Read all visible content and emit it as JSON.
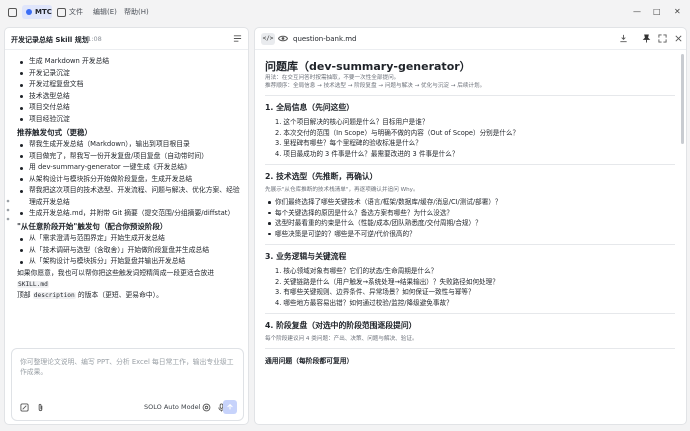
{
  "titlebar": {
    "app_label": "MTC",
    "menus": [
      "文件",
      "编辑(E)",
      "帮助(H)"
    ],
    "controls": [
      "—",
      "□",
      "✕"
    ]
  },
  "left": {
    "title": "开发记录总结 Skill 规划",
    "time": "21:08",
    "items": [
      {
        "kind": "li",
        "text": "生成 Markdown 开发总结"
      },
      {
        "kind": "li",
        "text": "开发记录沉淀"
      },
      {
        "kind": "li",
        "text": "开发过程复盘文档"
      },
      {
        "kind": "li",
        "text": "技术选型总结"
      },
      {
        "kind": "li",
        "text": "项目交付总结"
      },
      {
        "kind": "li",
        "text": "项目经验沉淀"
      },
      {
        "kind": "sec",
        "text": "推荐触发句式（更稳）"
      },
      {
        "kind": "li",
        "text": "帮我生成开发总结（Markdown），输出到项目根目录"
      },
      {
        "kind": "li",
        "text": "项目做完了，帮我写一份开发复盘/项目复盘（自动带时间）"
      },
      {
        "kind": "li",
        "text": "用 dev-summary-generator 一键生成《开发总结》"
      },
      {
        "kind": "li",
        "text": "从架构设计与模块拆分开始做阶段复盘，生成开发总结"
      },
      {
        "kind": "li",
        "text": "帮我把这次项目的技术选型、开发流程、问题与解决、优化方案、经验整"
      },
      {
        "kind": "cont",
        "text": "理成开发总结"
      },
      {
        "kind": "li",
        "text": "生成开发总结.md，并附带 Git 摘要（提交范围/分组摘要/diffstat）"
      },
      {
        "kind": "sec",
        "text": "\"从任意阶段开始\"触发句（配合你预设阶段）"
      },
      {
        "kind": "li",
        "text": "从「需求澄清与范围界定」开始生成开发总结"
      },
      {
        "kind": "li",
        "text": "从「技术调研与选型（含取舍）」开始做阶段复盘并生成总结"
      },
      {
        "kind": "li",
        "text": "从「架构设计与模块拆分」开始复盘并输出开发总结"
      },
      {
        "kind": "para",
        "text_a": "如果你愿意，我也可以帮你把这些触发词短精简成一段更适合放进 ",
        "code_a": "SKILL.md",
        "text_b": "顶部 ",
        "code_b": "description",
        "text_c": " 的版本（更短、更易命中）。"
      }
    ],
    "composer_placeholder": "你可整理论文说明、编写 PPT、分析 Excel 每日常工作，输出专业级工作成果。",
    "model_label": "SOLO Auto Model",
    "icons": [
      "attach-icon",
      "paperclip-icon",
      "at-icon",
      "mic-icon",
      "send-icon"
    ]
  },
  "right": {
    "file_name": "question-bank.md",
    "doc": {
      "title": "问题库（dev-summary-generator）",
      "meta_1": "用法：在交互问答时按需抽取，不要一次性全部提问。",
      "meta_2": "推荐顺序：全局信息 → 技术选型 → 阶段复盘 → 问题与解决 → 优化与沉淀 → 后续计划。",
      "sections": [
        {
          "heading": "1. 全局信息（先问这些）",
          "ordered": [
            "1. 这个项目解决的核心问题是什么？目标用户是谁？",
            "2. 本次交付的范围（In Scope）与明确不做的内容（Out of Scope）分别是什么？",
            "3. 里程碑有哪些？每个里程碑的验收标准是什么？",
            "4. 项目最成功的 3 件事是什么？最需要改进的 3 件事是什么？"
          ]
        },
        {
          "heading": "2. 技术选型（先推断，再确认）",
          "note": "先展示\"从仓库推断的技术栈清单\"，再逐项确认并追问 Why。",
          "bullets": [
            "你们最终选择了哪些关键技术（语言/框架/数据库/缓存/消息/CI/测试/部署）？",
            "每个关键选择的原因是什么？备选方案有哪些？为什么没选？",
            "选型时最看重的约束是什么（性能/成本/团队熟悉度/交付周期/合规）？",
            "哪些决策是可逆的？哪些是不可逆/代价很高的？"
          ]
        },
        {
          "heading": "3. 业务逻辑与关键流程",
          "ordered": [
            "1. 核心领域对象有哪些？它们的状态/生命周期是什么？",
            "2. 关键链路是什么（用户触发→系统处理→结果输出）？失败路径如何处理？",
            "3. 有哪些关键规则、边界条件、异常场景？如何保证一致性与幂等？",
            "4. 哪些地方最容易出错？如何通过校验/监控/降级避免事故？"
          ]
        },
        {
          "heading": "4. 阶段复盘（对选中的阶段范围逐段提问）",
          "note": "每个阶段建议问 4 类问题：产出、决策、问题与解决、验证。"
        }
      ],
      "subheading": "通用问题（每阶段都可复用）"
    }
  }
}
